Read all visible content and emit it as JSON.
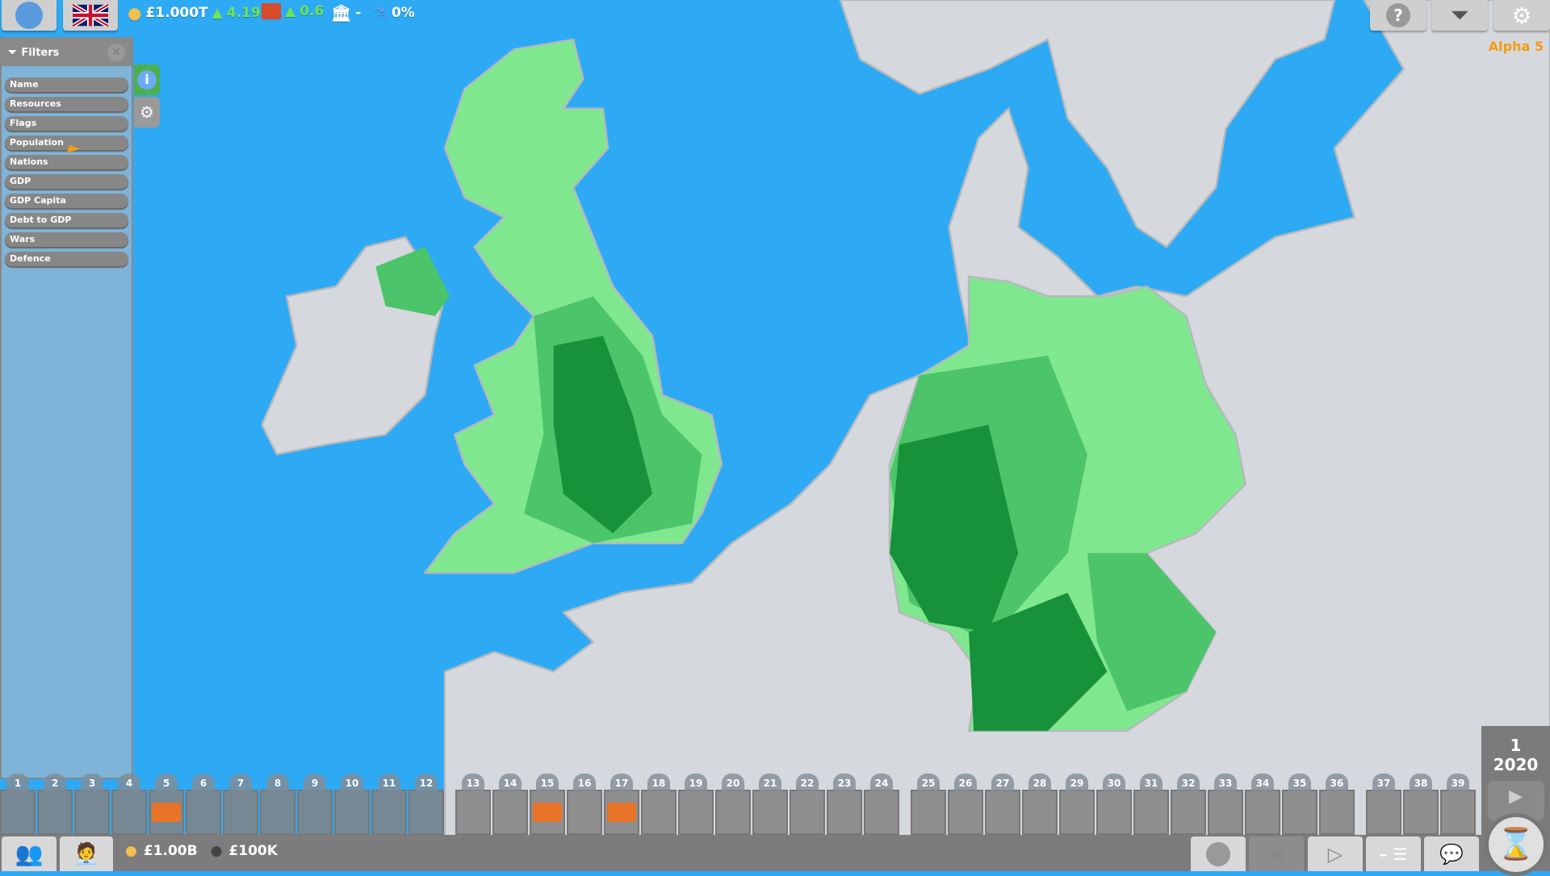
{
  "header": {
    "treasury": "£1.000T",
    "treasury_change": "4.19B",
    "industry_change": "0.6",
    "government": "-",
    "research": "0%",
    "version": "Alpha 5"
  },
  "filters": {
    "title": "Filters",
    "items": [
      "Name",
      "Resources",
      "Flags",
      "Population",
      "Nations",
      "GDP",
      "GDP Capita",
      "Debt to GDP",
      "Wars",
      "Defence"
    ]
  },
  "timeline": {
    "slots": [
      "1",
      "2",
      "3",
      "4",
      "5",
      "6",
      "7",
      "8",
      "9",
      "10",
      "11",
      "12",
      "13",
      "14",
      "15",
      "16",
      "17",
      "18",
      "19",
      "20",
      "21",
      "22",
      "23",
      "24",
      "25",
      "26",
      "27",
      "28",
      "29",
      "30",
      "31",
      "32",
      "33",
      "34",
      "35",
      "36",
      "37",
      "38",
      "39"
    ],
    "events": [
      {
        "slot": 5,
        "icon": "ballot-box-icon"
      },
      {
        "slot": 15,
        "icon": "debate-icon"
      },
      {
        "slot": 17,
        "icon": "ballot-box-icon"
      }
    ]
  },
  "bottom": {
    "money": "£1.00B",
    "debt": "£100K"
  },
  "date": {
    "turn": "1",
    "year": "2020"
  },
  "colors": {
    "sea": "#2eaaf5",
    "land": "#d5d8dc",
    "light_green": "#7fe88f",
    "mid_green": "#4cc46a",
    "dark_green": "#17913a",
    "alpha": "#f39c12"
  }
}
